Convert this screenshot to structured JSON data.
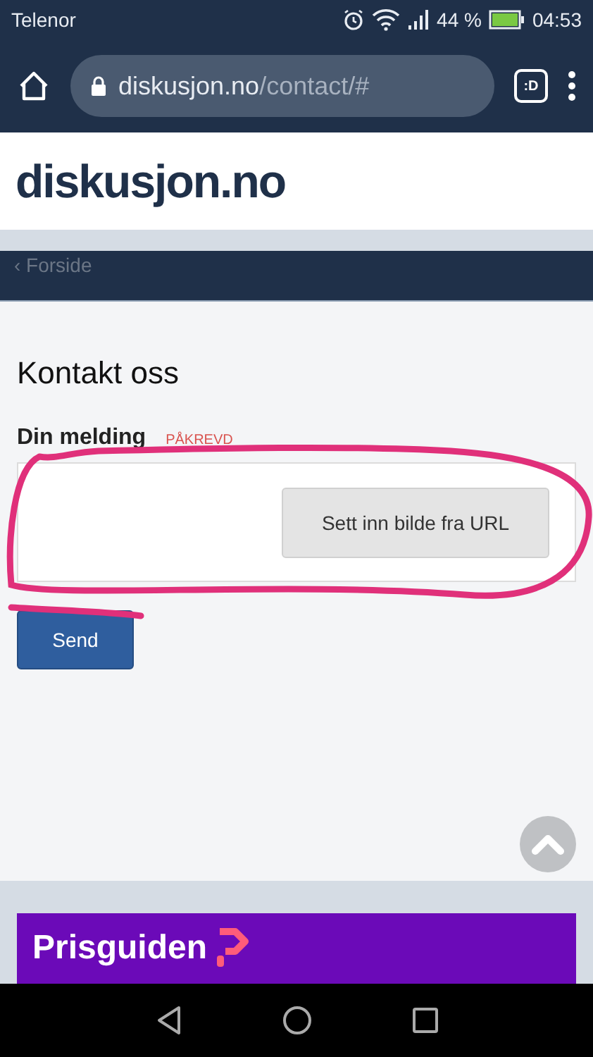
{
  "status_bar": {
    "carrier": "Telenor",
    "battery": "44 %",
    "time": "04:53"
  },
  "browser": {
    "url_host": "diskusjon.no",
    "url_path": "/contact/#",
    "tab_badge": ":D"
  },
  "site": {
    "logo": "diskusjon.no",
    "back_link": "‹ Forside"
  },
  "form": {
    "title": "Kontakt oss",
    "label": "Din melding",
    "required": "PÅKREVD",
    "insert_image_button": "Sett inn bilde fra URL",
    "submit": "Send"
  },
  "ad": {
    "brand": "Prisguiden"
  }
}
